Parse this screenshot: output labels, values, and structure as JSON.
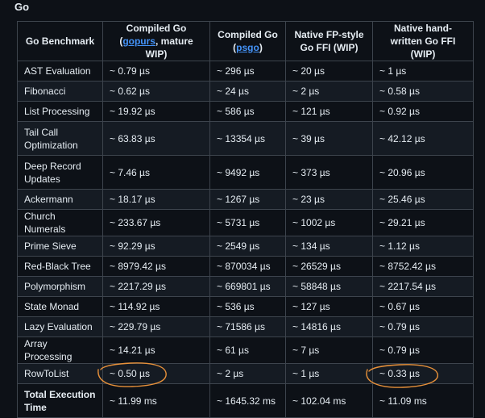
{
  "heading": "Go",
  "columns": [
    {
      "pre": "Go Benchmark",
      "link": "",
      "post": ""
    },
    {
      "pre": "Compiled Go (",
      "link": "gopurs",
      "post": ", mature WIP)"
    },
    {
      "pre": "Compiled Go (",
      "link": "psgo",
      "post": ")"
    },
    {
      "pre": "Native FP-style Go FFI (WIP)",
      "link": "",
      "post": ""
    },
    {
      "pre": "Native hand-written Go FFI (WIP)",
      "link": "",
      "post": ""
    }
  ],
  "rows": [
    {
      "cells": [
        "AST Evaluation",
        "~ 0.79 µs",
        "~ 296 µs",
        "~ 20 µs",
        "~ 1 µs"
      ]
    },
    {
      "cells": [
        "Fibonacci",
        "~ 0.62 µs",
        "~ 24 µs",
        "~ 2 µs",
        "~ 0.58 µs"
      ]
    },
    {
      "cells": [
        "List Processing",
        "~ 19.92 µs",
        "~ 586 µs",
        "~ 121 µs",
        "~ 0.92 µs"
      ]
    },
    {
      "cells": [
        "Tail Call Optimization",
        "~ 63.83 µs",
        "~ 13354 µs",
        "~ 39 µs",
        "~ 42.12 µs"
      ],
      "tall": true
    },
    {
      "cells": [
        "Deep Record Updates",
        "~ 7.46 µs",
        "~ 9492 µs",
        "~ 373 µs",
        "~ 20.96 µs"
      ],
      "tall": true
    },
    {
      "cells": [
        "Ackermann",
        "~ 18.17 µs",
        "~ 1267 µs",
        "~ 23 µs",
        "~ 25.46 µs"
      ]
    },
    {
      "cells": [
        "Church Numerals",
        "~ 233.67 µs",
        "~ 5731 µs",
        "~ 1002 µs",
        "~ 29.21 µs"
      ]
    },
    {
      "cells": [
        "Prime Sieve",
        "~ 92.29 µs",
        "~ 2549 µs",
        "~ 134 µs",
        "~ 1.12 µs"
      ]
    },
    {
      "cells": [
        "Red-Black Tree",
        "~ 8979.42 µs",
        "~ 870034 µs",
        "~ 26529 µs",
        "~ 8752.42 µs"
      ]
    },
    {
      "cells": [
        "Polymorphism",
        "~ 2217.29 µs",
        "~ 669801 µs",
        "~ 58848 µs",
        "~ 2217.54 µs"
      ]
    },
    {
      "cells": [
        "State Monad",
        "~ 114.92 µs",
        "~ 536 µs",
        "~ 127 µs",
        "~ 0.67 µs"
      ]
    },
    {
      "cells": [
        "Lazy Evaluation",
        "~ 229.79 µs",
        "~ 71586 µs",
        "~ 14816 µs",
        "~ 0.79 µs"
      ]
    },
    {
      "cells": [
        "Array Processing",
        "~ 14.21 µs",
        "~ 61 µs",
        "~ 7 µs",
        "~ 0.79 µs"
      ]
    },
    {
      "cells": [
        "RowToList",
        "~ 0.50 µs",
        "~ 2 µs",
        "~ 1 µs",
        "~ 0.33 µs"
      ]
    },
    {
      "cells": [
        "Total Execution Time",
        "~ 11.99 ms",
        "~ 1645.32 ms",
        "~ 102.04 ms",
        "~ 11.09 ms"
      ],
      "tall": true,
      "bold_first": true
    }
  ],
  "colors": {
    "annotation": "#e8913a",
    "link": "#4493f8",
    "border": "#3d444d"
  }
}
